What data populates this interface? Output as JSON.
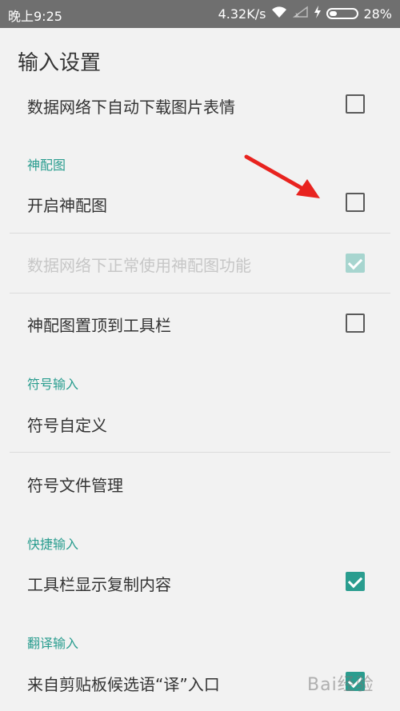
{
  "status_bar": {
    "time": "晚上9:25",
    "net_speed": "4.32K/s",
    "battery_percent": "28%",
    "battery_level": 0.28
  },
  "page": {
    "title": "输入设置"
  },
  "items": {
    "auto_download": {
      "label": "数据网络下自动下载图片表情",
      "checked": false
    },
    "section_shenpeitu": {
      "header": "神配图"
    },
    "enable_shenpeitu": {
      "label": "开启神配图",
      "checked": false
    },
    "normal_use_shenpeitu": {
      "label": "数据网络下正常使用神配图功能",
      "checked": true,
      "disabled": true
    },
    "pin_shenpeitu": {
      "label": "神配图置顶到工具栏",
      "checked": false
    },
    "section_symbol": {
      "header": "符号输入"
    },
    "symbol_custom": {
      "label": "符号自定义"
    },
    "symbol_file_manage": {
      "label": "符号文件管理"
    },
    "section_quick": {
      "header": "快捷输入"
    },
    "toolbar_show_copy": {
      "label": "工具栏显示复制内容",
      "checked": true
    },
    "section_translate": {
      "header": "翻译输入"
    },
    "clipboard_translate": {
      "label": "来自剪贴板候选语“译”入口",
      "checked": true
    }
  },
  "watermark": "Bai经验",
  "colors": {
    "accent": "#2a9d8f",
    "status_bar": "#6f6f6f",
    "arrow": "#e8231f"
  }
}
